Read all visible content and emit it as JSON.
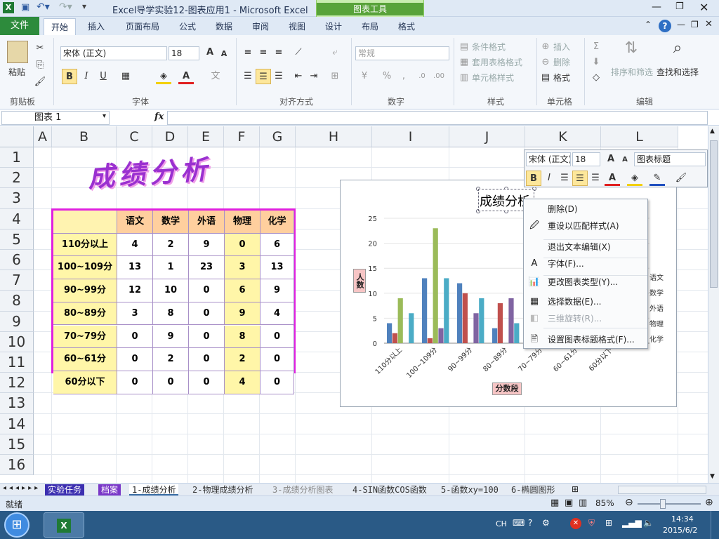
{
  "titlebar": {
    "title": "Excel导学实验12-图表应用1  -  Microsoft Excel",
    "context_group": "图表工具"
  },
  "tabs": [
    "文件",
    "开始",
    "插入",
    "页面布局",
    "公式",
    "数据",
    "审阅",
    "视图",
    "设计",
    "布局",
    "格式"
  ],
  "ribbon": {
    "clipboard": {
      "paste": "粘贴",
      "label": "剪贴板"
    },
    "font": {
      "name": "宋体 (正文)",
      "size": "18",
      "label": "字体",
      "bold": "B",
      "italic": "I",
      "underline": "U"
    },
    "align": {
      "label": "对齐方式"
    },
    "number": {
      "format": "常规",
      "label": "数字"
    },
    "styles": {
      "cond": "条件格式",
      "table": "套用表格格式",
      "cell": "单元格样式",
      "label": "样式"
    },
    "cells": {
      "insert": "插入",
      "delete": "删除",
      "format": "格式",
      "label": "单元格"
    },
    "edit": {
      "sort": "排序和筛选",
      "find": "查找和选择",
      "label": "编辑"
    }
  },
  "formula": {
    "namebox": "图表 1",
    "fx": "fx"
  },
  "grid": {
    "cols": [
      "A",
      "B",
      "C",
      "D",
      "E",
      "F",
      "G",
      "H",
      "I",
      "J",
      "K",
      "L"
    ],
    "rows": [
      "1",
      "2",
      "3",
      "4",
      "5",
      "6",
      "7",
      "8",
      "9",
      "10",
      "11",
      "12",
      "13",
      "14",
      "15",
      "16"
    ],
    "big_title": "成绩分析"
  },
  "table": {
    "headers": [
      "",
      "语文",
      "数学",
      "外语",
      "物理",
      "化学"
    ],
    "rows": [
      [
        "110分以上",
        "4",
        "2",
        "9",
        "0",
        "6"
      ],
      [
        "100~109分",
        "13",
        "1",
        "23",
        "3",
        "13"
      ],
      [
        "90~99分",
        "12",
        "10",
        "0",
        "6",
        "9"
      ],
      [
        "80~89分",
        "3",
        "8",
        "0",
        "9",
        "4"
      ],
      [
        "70~79分",
        "0",
        "9",
        "0",
        "8",
        "0"
      ],
      [
        "60~61分",
        "0",
        "2",
        "0",
        "2",
        "0"
      ],
      [
        "60分以下",
        "0",
        "0",
        "0",
        "4",
        "0"
      ]
    ]
  },
  "chart_data": {
    "type": "bar",
    "title": "成绩分析",
    "categories": [
      "110分以上",
      "100~109分",
      "90~99分",
      "80~89分",
      "70~79分",
      "60~61分",
      "60分以下"
    ],
    "series": [
      {
        "name": "语文",
        "values": [
          4,
          13,
          12,
          3,
          0,
          0,
          0
        ],
        "color": "#4f81bd"
      },
      {
        "name": "数学",
        "values": [
          2,
          1,
          10,
          8,
          9,
          2,
          0
        ],
        "color": "#c0504d"
      },
      {
        "name": "外语",
        "values": [
          9,
          23,
          0,
          0,
          0,
          0,
          0
        ],
        "color": "#9bbb59"
      },
      {
        "name": "物理",
        "values": [
          0,
          3,
          6,
          9,
          8,
          2,
          4
        ],
        "color": "#8064a2"
      },
      {
        "name": "化学",
        "values": [
          6,
          13,
          9,
          4,
          0,
          0,
          0
        ],
        "color": "#4bacc6"
      }
    ],
    "ylim": [
      0,
      25
    ],
    "yticks": [
      "0",
      "5",
      "10",
      "15",
      "20",
      "25"
    ],
    "ylabel": "人数",
    "xlabel": "分数段",
    "legend_visible": [
      "语文",
      "数学",
      "外语",
      "物理",
      "化学"
    ]
  },
  "minitool": {
    "font": "宋体 (正文)",
    "size": "18",
    "element": "图表标题"
  },
  "context_menu": [
    {
      "label": "删除(D)",
      "enabled": true
    },
    {
      "label": "重设以匹配样式(A)",
      "enabled": true
    },
    {
      "label": "退出文本编辑(X)",
      "enabled": true
    },
    {
      "label": "字体(F)...",
      "enabled": true
    },
    {
      "label": "更改图表类型(Y)...",
      "enabled": true
    },
    {
      "label": "选择数据(E)...",
      "enabled": true
    },
    {
      "label": "三维旋转(R)...",
      "enabled": false
    },
    {
      "label": "设置图表标题格式(F)...",
      "enabled": true
    }
  ],
  "sheettabs": [
    "实验任务",
    "档案",
    "1-成绩分析",
    "2-物理成绩分析",
    "3-成绩分析图表",
    "4-SIN函数COS函数",
    "5-函数xy=100",
    "6-椭圆图形"
  ],
  "status": {
    "ready": "就绪",
    "zoom": "85%"
  },
  "taskbar": {
    "lang": "CH",
    "time": "14:34",
    "date": "2015/6/2"
  }
}
